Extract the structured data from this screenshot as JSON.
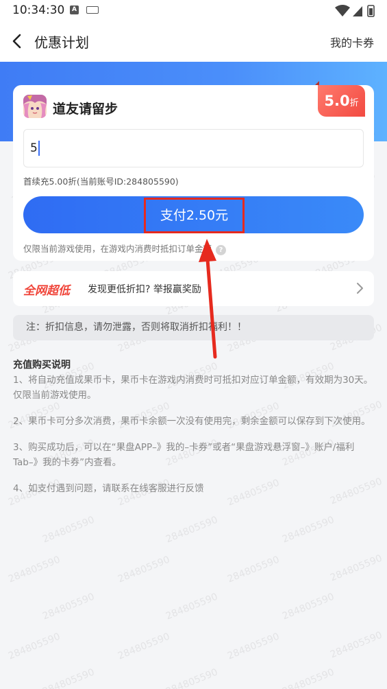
{
  "status": {
    "time": "10:34:30"
  },
  "nav": {
    "title": "优惠计划",
    "right_link": "我的卡券"
  },
  "watermark": "284805590",
  "game": {
    "name": "道友请留步"
  },
  "discount": {
    "value": "5.0",
    "unit": "折"
  },
  "input": {
    "value": "5"
  },
  "renew_info": "首续充5.00折(当前账号ID:284805590)",
  "pay_button": "支付2.50元",
  "limit_note": "仅限当前游戏使用，在游戏内消费时抵扣订单金额",
  "help_icon_label": "?",
  "promo": {
    "tag": "全网超低",
    "text": "发现更低折扣? 举报赢奖励"
  },
  "warning": "注：折扣信息，请勿泄露，否则将取消折扣福利！！",
  "instructions": {
    "title": "充值购买说明",
    "items": [
      "1、将自动充值成果币卡，果币卡在游戏内消费时可抵扣对应订单金额，有效期为30天。仅限当前游戏使用。",
      "2、果币卡可分多次消费，果币卡余额一次没有使用完，剩余金额可以保存到下次使用。",
      "3、购买成功后，可以在“果盘APP–》我的–卡券”或者“果盘游戏悬浮窗–》账户/福利Tab–》我的卡券”内查看。",
      "4、如支付遇到问题，请联系在线客服进行反馈"
    ]
  },
  "colors": {
    "accent": "#3a7cf6",
    "badge": "#f24a41",
    "annotation": "#e62a1e"
  }
}
